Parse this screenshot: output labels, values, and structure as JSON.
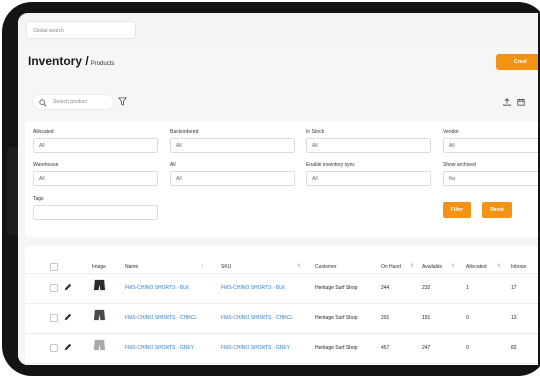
{
  "header": {
    "global_search_placeholder": "Global search"
  },
  "page": {
    "title": "Inventory /",
    "subtitle": "Products",
    "create_label": "Creat"
  },
  "toolbar": {
    "search_placeholder": "Search product"
  },
  "filters": {
    "allocated": {
      "label": "Allocated",
      "value": "All"
    },
    "backordered": {
      "label": "Backordered",
      "value": "All"
    },
    "in_stock": {
      "label": "In Stock",
      "value": "All"
    },
    "vendor": {
      "label": "Vendor",
      "value": "All"
    },
    "warehouse": {
      "label": "Warehouse",
      "value": "All"
    },
    "all_col2": {
      "label": "All",
      "value": "All"
    },
    "inventory_sync": {
      "label": "Enable inventory sync",
      "value": "All"
    },
    "show_archived": {
      "label": "Show archived",
      "value": "No"
    },
    "tags": {
      "label": "Tags",
      "value": ""
    },
    "filter_button": "Filter",
    "reset_button": "Reset"
  },
  "table": {
    "columns": {
      "image": "Image",
      "name": "Name",
      "sku": "SKU",
      "customer": "Customer",
      "on_hand": "On Hand",
      "available": "Available",
      "allocated": "Allocated",
      "inbound": "Inboun"
    },
    "rows": [
      {
        "name": "FMS-CHINO SHORTS - BLK",
        "sku": "FMS-CHINO SHORTS - BLK",
        "customer": "Heritage Surf Shop",
        "on_hand": "244",
        "available": "232",
        "allocated": "1",
        "inbound": "17",
        "color": "#2a2a2a"
      },
      {
        "name": "FMS-CHINO SHORTS - CHRCL",
        "sku": "FMS-CHINO SHORTS - CHRCL",
        "customer": "Heritage Surf Shop",
        "on_hand": "201",
        "available": "191",
        "allocated": "0",
        "inbound": "13",
        "color": "#4a4a4a"
      },
      {
        "name": "FMS-CHINO SHORTS - GREY",
        "sku": "FMS-CHINO SHORTS - GREY",
        "customer": "Heritage Surf Shop",
        "on_hand": "457",
        "available": "247",
        "allocated": "0",
        "inbound": "82",
        "color": "#a9a9a9"
      }
    ]
  },
  "colors": {
    "accent": "#f39314",
    "link": "#2b7fd4",
    "frame": "#141414"
  }
}
